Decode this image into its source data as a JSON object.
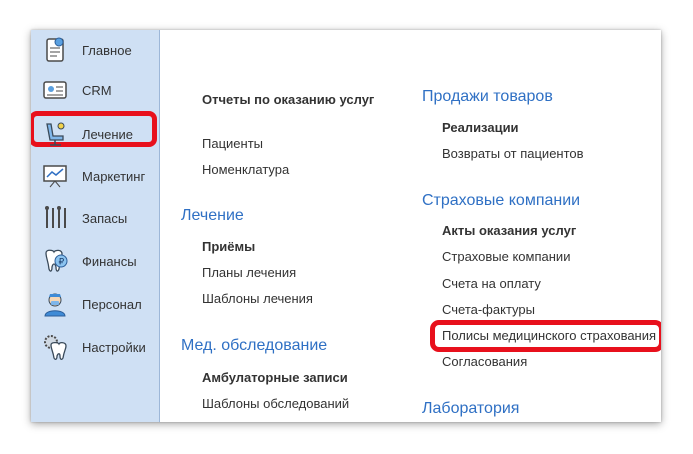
{
  "sidebar": {
    "items": [
      {
        "label": "Главное",
        "icon": "home-clipboard-icon"
      },
      {
        "label": "CRM",
        "icon": "crm-card-icon"
      },
      {
        "label": "Лечение",
        "icon": "dental-chair-icon"
      },
      {
        "label": "Маркетинг",
        "icon": "presentation-board-icon"
      },
      {
        "label": "Запасы",
        "icon": "dental-tools-icon"
      },
      {
        "label": "Финансы",
        "icon": "tooth-coin-icon"
      },
      {
        "label": "Персонал",
        "icon": "doctor-icon"
      },
      {
        "label": "Настройки",
        "icon": "tooth-gear-icon"
      }
    ]
  },
  "left_column": {
    "top_link": "Отчеты по оказанию услуг",
    "links_a": [
      "Пациенты",
      "Номенклатура"
    ],
    "section_treatment": {
      "title": "Лечение",
      "links": [
        "Приёмы",
        "Планы лечения",
        "Шаблоны лечения"
      ]
    },
    "section_exam": {
      "title": "Мед. обследование",
      "links": [
        "Амбулаторные записи",
        "Шаблоны обследований"
      ]
    }
  },
  "right_column": {
    "section_sales": {
      "title": "Продажи товаров",
      "links": [
        "Реализации",
        "Возвраты от пациентов"
      ]
    },
    "section_insurance": {
      "title": "Страховые компании",
      "links": [
        "Акты оказания услуг",
        "Страховые компании",
        "Счета на оплату",
        "Счета-фактуры",
        "Полисы медицинского страхования",
        "Согласования"
      ]
    },
    "section_lab": {
      "title": "Лаборатория"
    }
  },
  "colors": {
    "accent": "#2f70c4",
    "highlight": "#e8101c",
    "sidebar_bg": "#cfe0f4"
  }
}
